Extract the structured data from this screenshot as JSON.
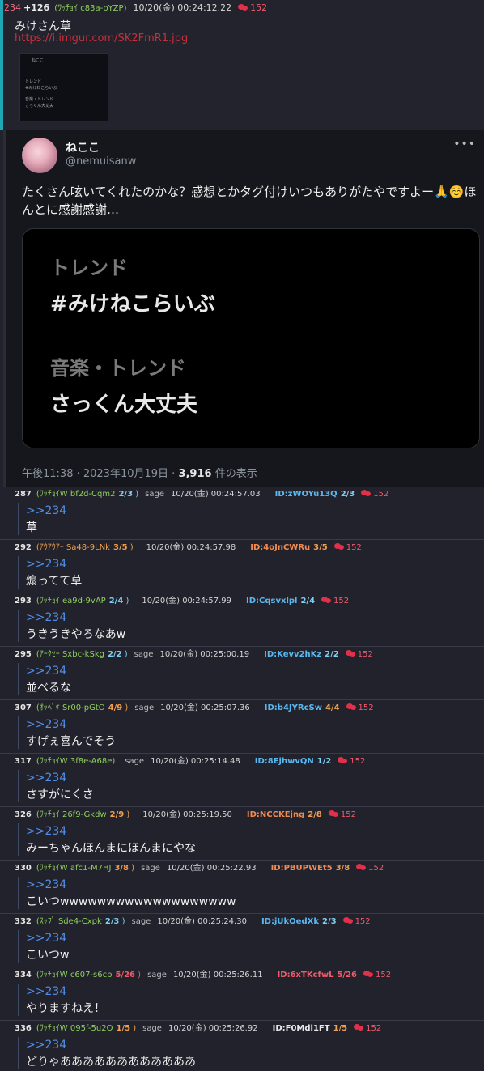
{
  "post": {
    "number": "234",
    "plus": "+126",
    "name": "(ﾜｯﾁｮｲ c83a-pYZP)",
    "date": "10/20(金) 00:24:12.22",
    "count": "152",
    "body": "みけさん草",
    "link": "https://i.imgur.com/SK2FmR1.jpg"
  },
  "tweet": {
    "username": "ねここ",
    "handle": "@nemuisanw",
    "text": "たくさん呟いてくれたのかな？感想とかタグ付けいつもありがたやですよー🙏☺️ほんとに感謝感謝…",
    "card": {
      "l1": "トレンド",
      "l2": "#みけねこらいぶ",
      "l3": "音楽・トレンド",
      "l4": "さっくん大丈夫"
    },
    "time": "午後11:38 · 2023年10月19日 · ",
    "views": "3,916",
    "views_suffix": " 件の表示"
  },
  "replies": [
    {
      "no": "287",
      "name": "(ﾜｯﾁｮｲW bf2d-Cqm2",
      "frac": "2/3",
      "sage": "sage",
      "date": "10/20(金) 00:24:57.03",
      "id": "ID:zWOYu13Q",
      "idfrac": "2/3",
      "count": "152",
      "anchor": ">>234",
      "text": "草",
      "nc": "#8fd05e",
      "fc": "#7fd0f0",
      "ic": "#58b8f0"
    },
    {
      "no": "292",
      "name": "(ｱｳｱｳｱｰ Sa48-9LNk",
      "frac": "3/5",
      "sage": "",
      "date": "10/20(金) 00:24:57.98",
      "id": "ID:4oJnCWRu",
      "idfrac": "3/5",
      "count": "152",
      "anchor": ">>234",
      "text": "煽ってて草",
      "nc": "#f0a050",
      "fc": "#f0a050",
      "ic": "#f08a50"
    },
    {
      "no": "293",
      "name": "(ﾜｯﾁｮｲ ea9d-9vAP",
      "frac": "2/4",
      "sage": "",
      "date": "10/20(金) 00:24:57.99",
      "id": "ID:Cqsvxlpl",
      "idfrac": "2/4",
      "count": "152",
      "anchor": ">>234",
      "text": "うきうきやろなあw",
      "nc": "#8fd05e",
      "fc": "#7fd0f0",
      "ic": "#58b8f0"
    },
    {
      "no": "295",
      "name": "(ｱｰｸｾｰ Sxbc-kSkg",
      "frac": "2/2",
      "sage": "sage",
      "date": "10/20(金) 00:25:00.19",
      "id": "ID:Kevv2hKz",
      "idfrac": "2/2",
      "count": "152",
      "anchor": ">>234",
      "text": "並べるな",
      "nc": "#8fd05e",
      "fc": "#7fd0f0",
      "ic": "#58b8f0"
    },
    {
      "no": "307",
      "name": "(ｵｯﾍﾟｹ Sr00-pGtO",
      "frac": "4/9",
      "sage": "sage",
      "date": "10/20(金) 00:25:07.36",
      "id": "ID:b4JYRcSw",
      "idfrac": "4/4",
      "count": "152",
      "anchor": ">>234",
      "text": "すげぇ喜んでそう",
      "nc": "#8fd05e",
      "fc": "#f0a050",
      "ic": "#58b8f0"
    },
    {
      "no": "317",
      "name": "(ﾜｯﾁｮｲW 3f8e-A68e)",
      "frac": "",
      "sage": "sage",
      "date": "10/20(金) 00:25:14.48",
      "id": "ID:8EjhwvQN",
      "idfrac": "1/2",
      "count": "152",
      "anchor": ">>234",
      "text": "さすがにくさ",
      "nc": "#8fd05e",
      "fc": "#7fd0f0",
      "ic": "#58b8f0"
    },
    {
      "no": "326",
      "name": "(ﾜｯﾁｮｲ 26f9-Gkdw",
      "frac": "2/9",
      "sage": "",
      "date": "10/20(金) 00:25:19.50",
      "id": "ID:NCCKEjng",
      "idfrac": "2/8",
      "count": "152",
      "anchor": ">>234",
      "text": "みーちゃんほんまにほんまにやな",
      "nc": "#8fd05e",
      "fc": "#f0a050",
      "ic": "#f08a50"
    },
    {
      "no": "330",
      "name": "(ﾜｯﾁｮｲW afc1-M7HJ",
      "frac": "3/8",
      "sage": "sage",
      "date": "10/20(金) 00:25:22.93",
      "id": "ID:PBUPWEt5",
      "idfrac": "3/8",
      "count": "152",
      "anchor": ">>234",
      "text": "こいつwwwwwwwwwwwwwwwwwww",
      "nc": "#8fd05e",
      "fc": "#f0a050",
      "ic": "#f08a50"
    },
    {
      "no": "332",
      "name": "(ｽｯﾌﾟ Sde4-Cxpk",
      "frac": "2/3",
      "sage": "sage",
      "date": "10/20(金) 00:25:24.30",
      "id": "ID:jUkOedXk",
      "idfrac": "2/3",
      "count": "152",
      "anchor": ">>234",
      "text": "こいつw",
      "nc": "#8fd05e",
      "fc": "#7fd0f0",
      "ic": "#58b8f0"
    },
    {
      "no": "334",
      "name": "(ﾜｯﾁｮｲW c607-s6cp",
      "frac": "5/26",
      "sage": "sage",
      "date": "10/20(金) 00:25:26.11",
      "id": "ID:6xTKcfwL",
      "idfrac": "5/26",
      "count": "152",
      "anchor": ">>234",
      "text": "やりますねえ！",
      "nc": "#8fd05e",
      "fc": "#f05a6a",
      "ic": "#f05a6a"
    },
    {
      "no": "336",
      "name": "(ﾜｯﾁｮｲW 095f-5u2O",
      "frac": "1/5",
      "sage": "sage",
      "date": "10/20(金) 00:25:26.92",
      "id": "ID:F0Mdl1FT",
      "idfrac": "1/5",
      "count": "152",
      "anchor": ">>234",
      "text": "どりゃああああああああああああ",
      "nc": "#8fd05e",
      "fc": "#f0a050",
      "ic": "#e8e8e8"
    }
  ]
}
